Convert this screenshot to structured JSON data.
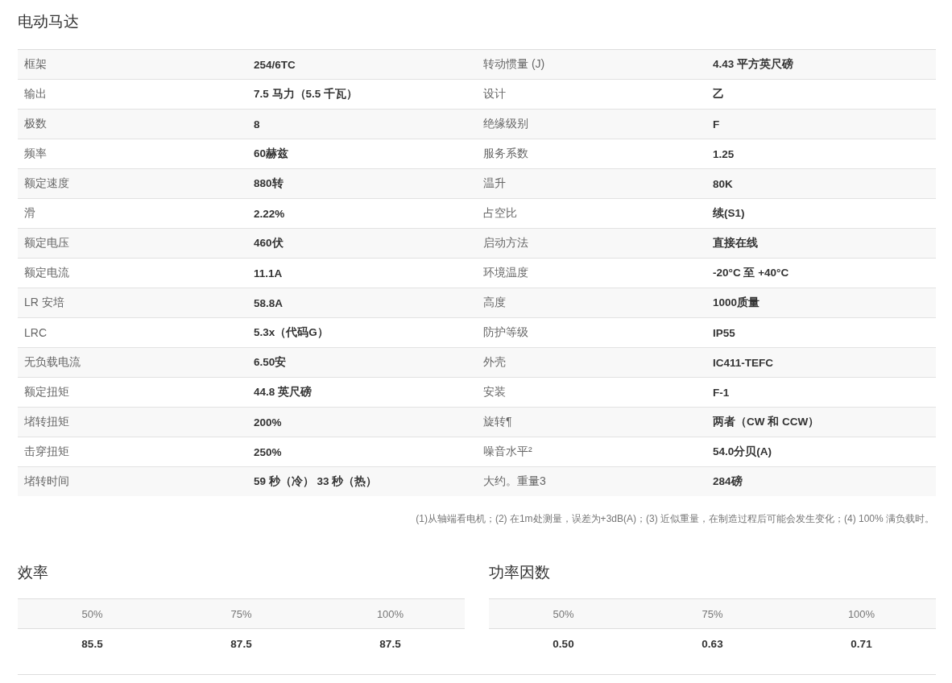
{
  "title": "电动马达",
  "specs": [
    {
      "label": "框架",
      "value": "254/6TC",
      "label_2": "转动惯量 (J)",
      "value_2": "4.43 平方英尺磅"
    },
    {
      "label": "输出",
      "value": "7.5 马力（5.5 千瓦）",
      "label_2": "设计",
      "value_2": "乙"
    },
    {
      "label": "极数",
      "value": "8",
      "label_2": "绝缘级别",
      "value_2": "F"
    },
    {
      "label": "频率",
      "value": "60赫兹",
      "label_2": "服务系数",
      "value_2": "1.25"
    },
    {
      "label": "额定速度",
      "value": "880转",
      "label_2": "温升",
      "value_2": "80K"
    },
    {
      "label": "滑",
      "value": "2.22%",
      "label_2": "占空比",
      "value_2": "续(S1)"
    },
    {
      "label": "额定电压",
      "value": "460伏",
      "label_2": "启动方法",
      "value_2": "直接在线"
    },
    {
      "label": "额定电流",
      "value": "11.1A",
      "label_2": "环境温度",
      "value_2": "-20°C 至 +40°C"
    },
    {
      "label": "LR 安培",
      "value": "58.8A",
      "label_2": "高度",
      "value_2": "1000质量"
    },
    {
      "label": "LRC",
      "value": "5.3x（代码G）",
      "label_2": "防护等级",
      "value_2": "IP55"
    },
    {
      "label": "无负载电流",
      "value": "6.50安",
      "label_2": "外壳",
      "value_2": "IC411-TEFC"
    },
    {
      "label": "额定扭矩",
      "value": "44.8 英尺磅",
      "label_2": "安装",
      "value_2": "F-1"
    },
    {
      "label": "堵转扭矩",
      "value": "200%",
      "label_2": "旋转¶",
      "value_2": "两者（CW 和 CCW）"
    },
    {
      "label": "击穿扭矩",
      "value": "250%",
      "label_2": "噪音水平²",
      "value_2": "54.0分贝(A)"
    },
    {
      "label": "堵转时间",
      "value": "59 秒（冷） 33 秒（热）",
      "label_2": "大约。重量3",
      "value_2": "284磅"
    }
  ],
  "footnote": "(1)从轴端看电机；(2) 在1m处测量，误差为+3dB(A)；(3) 近似重量，在制造过程后可能会发生变化；(4) 100% 满负载时。",
  "load_tables": [
    {
      "title": "效率",
      "headers": [
        "50%",
        "75%",
        "100%"
      ],
      "values": [
        "85.5",
        "87.5",
        "87.5"
      ]
    },
    {
      "title": "功率因数",
      "headers": [
        "50%",
        "75%",
        "100%"
      ],
      "values": [
        "0.50",
        "0.63",
        "0.71"
      ]
    }
  ]
}
